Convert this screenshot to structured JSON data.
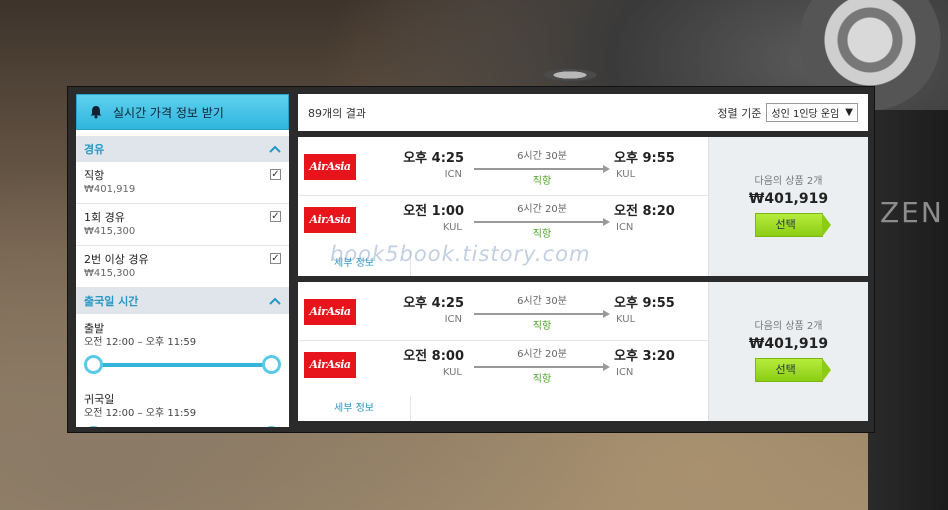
{
  "background": {
    "camera_text": "ZEN"
  },
  "sidebar": {
    "alert_label": "실시간 가격 정보 받기",
    "stops_section": {
      "title": "경유",
      "options": [
        {
          "label": "직항",
          "price": "₩401,919",
          "checked": true
        },
        {
          "label": "1회 경유",
          "price": "₩415,300",
          "checked": true
        },
        {
          "label": "2번 이상 경유",
          "price": "₩415,300",
          "checked": true
        }
      ]
    },
    "time_section": {
      "title": "출국일 시간",
      "outbound": {
        "label": "출발",
        "range": "오전 12:00 – 오후 11:59"
      },
      "return": {
        "label": "귀국일",
        "range": "오전 12:00 – 오후 11:59"
      }
    }
  },
  "results": {
    "count_label": "89개의 결과",
    "sort_label": "정렬 기준",
    "sort_value": "성인 1인당 운임",
    "watermark": "book5book.tistory.com",
    "cards": [
      {
        "legs": [
          {
            "airline": "AirAsia",
            "dep_time": "오후 4:25",
            "dep_code": "ICN",
            "duration": "6시간 30분",
            "stops": "직항",
            "arr_time": "오후 9:55",
            "arr_code": "KUL"
          },
          {
            "airline": "AirAsia",
            "dep_time": "오전 1:00",
            "dep_code": "KUL",
            "duration": "6시간 20분",
            "stops": "직항",
            "arr_time": "오전 8:20",
            "arr_code": "ICN"
          }
        ],
        "details_label": "세부 정보",
        "other_label": "다음의 상품 2개",
        "price": "₩401,919",
        "select_label": "선택"
      },
      {
        "legs": [
          {
            "airline": "AirAsia",
            "dep_time": "오후 4:25",
            "dep_code": "ICN",
            "duration": "6시간 30분",
            "stops": "직항",
            "arr_time": "오후 9:55",
            "arr_code": "KUL"
          },
          {
            "airline": "AirAsia",
            "dep_time": "오전 8:00",
            "dep_code": "KUL",
            "duration": "6시간 20분",
            "stops": "직항",
            "arr_time": "오후 3:20",
            "arr_code": "ICN"
          }
        ],
        "details_label": "세부 정보",
        "other_label": "다음의 상품 2개",
        "price": "₩401,919",
        "select_label": "선택"
      }
    ]
  },
  "colors": {
    "accent": "#2797c4",
    "select_green": "#8ccd14",
    "direct_green": "#4da82a",
    "airasia_red": "#e8141c"
  }
}
